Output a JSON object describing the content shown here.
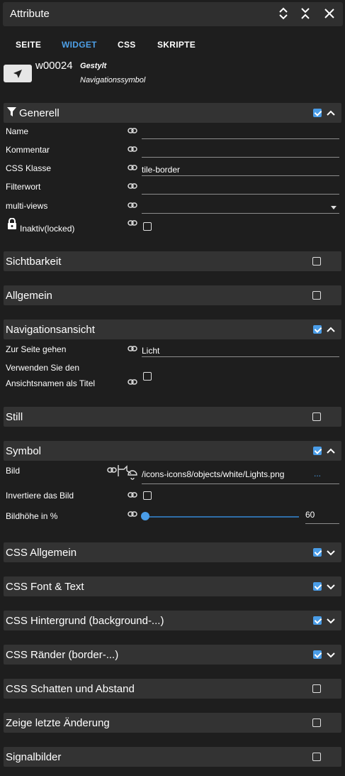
{
  "window": {
    "title": "Attribute"
  },
  "tabs": [
    {
      "label": "SEITE"
    },
    {
      "label": "WIDGET"
    },
    {
      "label": "CSS"
    },
    {
      "label": "SKRIPTE"
    }
  ],
  "widget": {
    "id": "w00024",
    "style": "Gestylt",
    "type": "Navigationssymbol"
  },
  "sections": {
    "generell": "Generell",
    "sichtbarkeit": "Sichtbarkeit",
    "allgemein": "Allgemein",
    "navigationsansicht": "Navigationsansicht",
    "still": "Still",
    "symbol": "Symbol",
    "css_allgemein": "CSS Allgemein",
    "css_font": "CSS Font & Text",
    "css_hintergrund": "CSS Hintergrund (background-...)",
    "css_raender": "CSS Ränder (border-...)",
    "css_schatten": "CSS Schatten und Abstand",
    "letzte_aenderung": "Zeige letzte Änderung",
    "signalbilder": "Signalbilder"
  },
  "generell": {
    "name_label": "Name",
    "name_value": "",
    "kommentar_label": "Kommentar",
    "kommentar_value": "",
    "css_klasse_label": "CSS Klasse",
    "css_klasse_value": "tile-border",
    "filterwort_label": "Filterwort",
    "filterwort_value": "",
    "multiviews_label": "multi-views",
    "multiviews_value": "",
    "inaktiv_label": "Inaktiv(locked)"
  },
  "navigation": {
    "seite_label": "Zur Seite gehen",
    "seite_value": "Licht",
    "titel_label_1": "Verwenden Sie den",
    "titel_label_2": "Ansichtsnamen als Titel"
  },
  "symbol": {
    "bild_label": "Bild",
    "bild_value": "/icons-icons8/objects/white/Lights.png",
    "bild_more": "...",
    "invert_label": "Invertiere das Bild",
    "hoehe_label": "Bildhöhe in %",
    "hoehe_value": "60"
  },
  "colors": {
    "accent": "#4a9de8",
    "panel": "#333333",
    "background": "#1e1e1e"
  }
}
